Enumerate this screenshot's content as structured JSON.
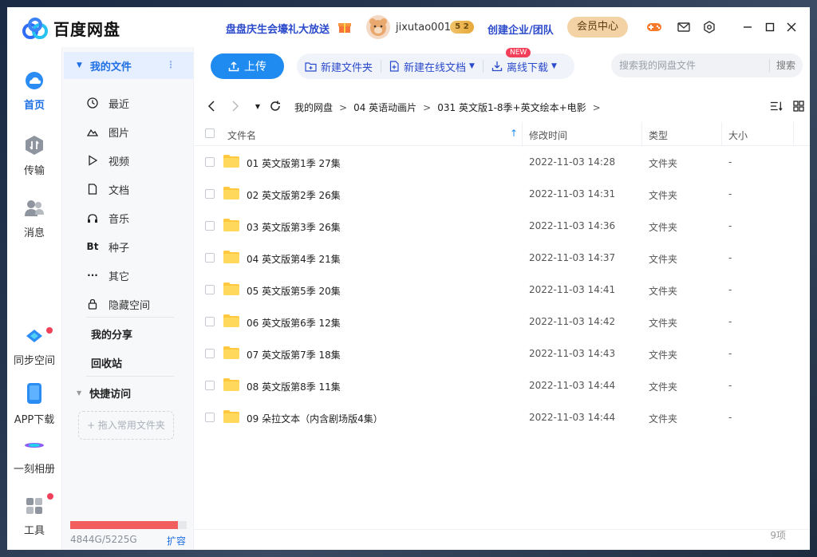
{
  "app": {
    "name": "百度网盘"
  },
  "header": {
    "promo": "盘盘庆生会壕礼大放送",
    "username": "jixutao001",
    "level": "5 2",
    "enterprise_link": "创建企业/团队",
    "vip_button": "会员中心"
  },
  "nav": {
    "home": "首页",
    "transfer": "传输",
    "messages": "消息",
    "sync": "同步空间",
    "app_download": "APP下载",
    "album": "一刻相册",
    "tools": "工具"
  },
  "sidebar": {
    "my_files": "我的文件",
    "items": [
      {
        "label": "最近",
        "icon": "clock-icon"
      },
      {
        "label": "图片",
        "icon": "image-icon"
      },
      {
        "label": "视频",
        "icon": "play-icon"
      },
      {
        "label": "文档",
        "icon": "document-icon"
      },
      {
        "label": "音乐",
        "icon": "headphones-icon"
      },
      {
        "label": "种子",
        "icon": "torrent-icon"
      },
      {
        "label": "其它",
        "icon": "more-icon"
      },
      {
        "label": "隐藏空间",
        "icon": "lock-icon"
      }
    ],
    "my_share": "我的分享",
    "recycle": "回收站",
    "quick_access": "快捷访问",
    "drop_hint": "+ 拖入常用文件夹",
    "quota": "4844G/5225G",
    "quota_fraction": 0.927,
    "expand": "扩容"
  },
  "toolbar": {
    "upload": "上传",
    "new_folder": "新建文件夹",
    "new_online_doc": "新建在线文档",
    "new_tag": "NEW",
    "offline_download": "离线下载",
    "search_placeholder": "搜索我的网盘文件",
    "search_button": "搜索"
  },
  "breadcrumb": [
    "我的网盘",
    "04 英语动画片",
    "031 英文版1-8季+英文绘本+电影"
  ],
  "table": {
    "headers": {
      "name": "文件名",
      "modified": "修改时间",
      "type": "类型",
      "size": "大小"
    },
    "rows": [
      {
        "name": "01 英文版第1季 27集",
        "modified": "2022-11-03 14:28",
        "type": "文件夹",
        "size": "-"
      },
      {
        "name": "02 英文版第2季 26集",
        "modified": "2022-11-03 14:31",
        "type": "文件夹",
        "size": "-"
      },
      {
        "name": "03 英文版第3季 26集",
        "modified": "2022-11-03 14:36",
        "type": "文件夹",
        "size": "-"
      },
      {
        "name": "04 英文版第4季 21集",
        "modified": "2022-11-03 14:37",
        "type": "文件夹",
        "size": "-"
      },
      {
        "name": "05 英文版第5季 20集",
        "modified": "2022-11-03 14:41",
        "type": "文件夹",
        "size": "-"
      },
      {
        "name": "06 英文版第6季 12集",
        "modified": "2022-11-03 14:42",
        "type": "文件夹",
        "size": "-"
      },
      {
        "name": "07 英文版第7季 18集",
        "modified": "2022-11-03 14:43",
        "type": "文件夹",
        "size": "-"
      },
      {
        "name": "08 英文版第8季 11集",
        "modified": "2022-11-03 14:44",
        "type": "文件夹",
        "size": "-"
      },
      {
        "name": "09 朵拉文本（内含剧场版4集）",
        "modified": "2022-11-03 14:44",
        "type": "文件夹",
        "size": "-"
      }
    ]
  },
  "status": {
    "count": "9项"
  },
  "colors": {
    "accent": "#1f6fe5",
    "upload": "#1f8bf0",
    "quota_fill": "#f25d5d",
    "folder": "#ffc83d"
  }
}
